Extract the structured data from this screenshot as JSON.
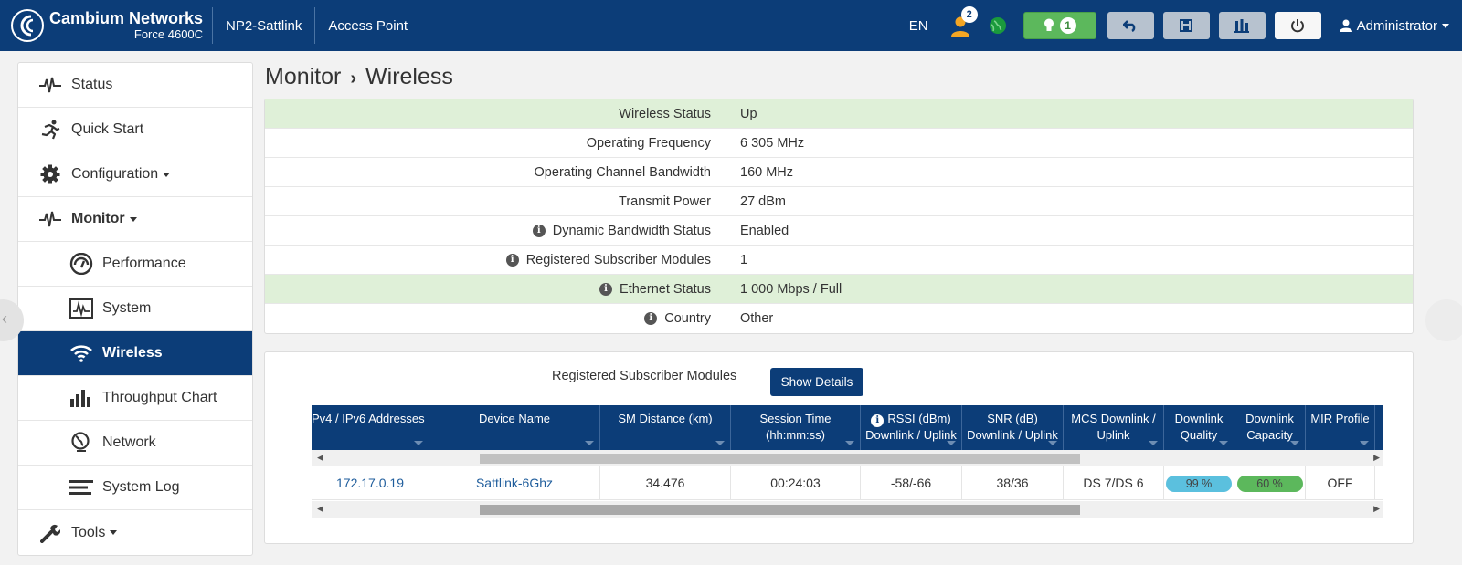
{
  "header": {
    "brand": "Cambium Networks",
    "model": "Force 4600C",
    "site_name": "NP2-Sattlink",
    "device_mode": "Access Point",
    "language": "EN",
    "alarm_count": "2",
    "green_button_count": "1",
    "user": "Administrator",
    "colors": {
      "bar": "#0c3d78",
      "accent_orange": "#f5a623",
      "accent_green": "#5cb85c"
    }
  },
  "sidebar": {
    "items": [
      {
        "label": "Status",
        "icon": "pulse-icon"
      },
      {
        "label": "Quick Start",
        "icon": "running-man-icon"
      },
      {
        "label": "Configuration",
        "icon": "gear-icon"
      },
      {
        "label": "Monitor",
        "icon": "pulse-icon"
      },
      {
        "label": "Performance",
        "icon": "speedometer-icon"
      },
      {
        "label": "System",
        "icon": "system-chart-icon"
      },
      {
        "label": "Wireless",
        "icon": "wifi-icon"
      },
      {
        "label": "Throughput Chart",
        "icon": "bar-chart-icon"
      },
      {
        "label": "Network",
        "icon": "globe-network-icon"
      },
      {
        "label": "System Log",
        "icon": "lines-icon"
      },
      {
        "label": "Tools",
        "icon": "wrench-icon"
      }
    ]
  },
  "breadcrumb": {
    "section": "Monitor",
    "page": "Wireless"
  },
  "status": {
    "rows": [
      {
        "label": "Wireless Status",
        "value": "Up"
      },
      {
        "label": "Operating Frequency",
        "value": "6 305 MHz"
      },
      {
        "label": "Operating Channel Bandwidth",
        "value": "160 MHz"
      },
      {
        "label": "Transmit Power",
        "value": "27 dBm"
      },
      {
        "label": "Dynamic Bandwidth Status",
        "value": "Enabled"
      },
      {
        "label": "Registered Subscriber Modules",
        "value": "1"
      },
      {
        "label": "Ethernet Status",
        "value": "1 000 Mbps / Full"
      },
      {
        "label": "Country",
        "value": "Other"
      }
    ]
  },
  "sm_panel": {
    "title": "Registered Subscriber Modules",
    "show_details_label": "Show Details",
    "columns": [
      {
        "line1": "Pv4 / IPv6 Addresses",
        "line2": ""
      },
      {
        "line1": "Device Name",
        "line2": ""
      },
      {
        "line1": "SM Distance (km)",
        "line2": ""
      },
      {
        "line1": "Session Time",
        "line2": "(hh:mm:ss)"
      },
      {
        "line1": "RSSI (dBm)",
        "line2": "Downlink / Uplink"
      },
      {
        "line1": "SNR (dB)",
        "line2": "Downlink / Uplink"
      },
      {
        "line1": "MCS Downlink /",
        "line2": "Uplink"
      },
      {
        "line1": "Downlink",
        "line2": "Quality"
      },
      {
        "line1": "Downlink",
        "line2": "Capacity"
      },
      {
        "line1": "MIR Profile",
        "line2": ""
      }
    ],
    "rows": [
      {
        "ip": "172.17.0.19",
        "device_name": "Sattlink-6Ghz",
        "distance": "34.476",
        "session_time": "00:24:03",
        "rssi": "-58/-66",
        "snr": "38/36",
        "mcs": "DS 7/DS 6",
        "quality": "99 %",
        "capacity": "60 %",
        "mir_profile": "OFF"
      }
    ],
    "colors": {
      "quality_pill": "#5bc0de",
      "capacity_pill": "#5cb85c"
    }
  }
}
